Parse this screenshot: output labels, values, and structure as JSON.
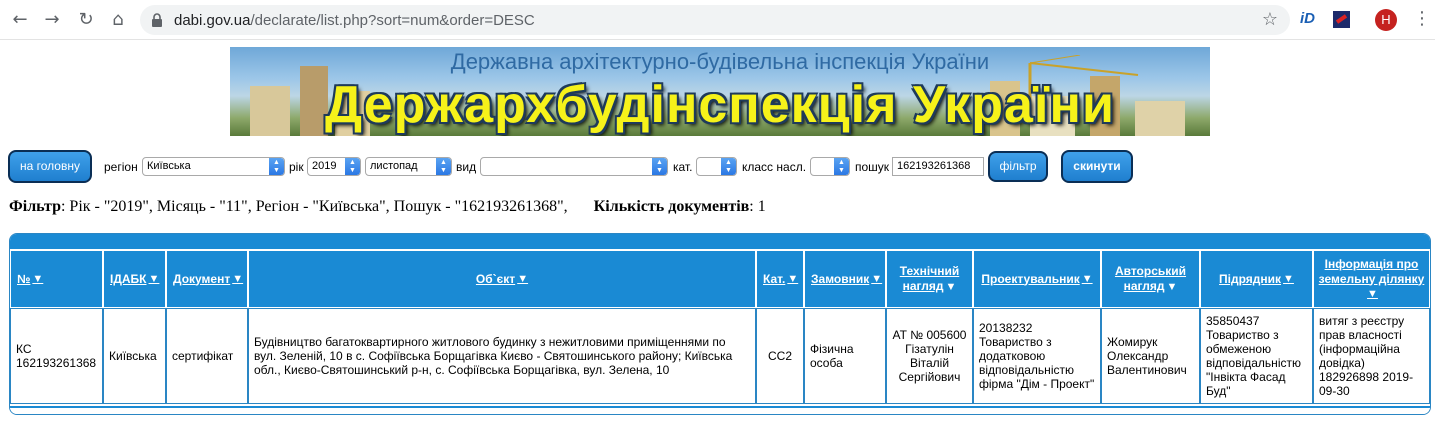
{
  "browser": {
    "url_host": "dabi.gov.ua",
    "url_path": "/declarate/list.php?sort=num&order=DESC",
    "ext_id_label": "iD",
    "avatar_letter": "H"
  },
  "banner": {
    "subtitle": "Державна архітектурно-будівельна інспекція України",
    "title": "Держархбудінспекція України"
  },
  "filters": {
    "home_button": "на головну",
    "region_label": "регіон",
    "region_value": "Київська",
    "year_label": "рік",
    "year_value": "2019",
    "month_value": "листопад",
    "type_label": "вид",
    "type_value": "",
    "cat_label": "кат.",
    "cat_value": "",
    "class_label": "класс насл.",
    "class_value": "",
    "search_label": "пошук",
    "search_value": "162193261368",
    "filter_button": "фільтр",
    "reset_button": "скинути"
  },
  "summary": {
    "filter_label": "Фільтр",
    "filter_text": ": Рік - \"2019\", Місяць - \"11\", Регіон - \"Київська\", Пошук - \"162193261368\",",
    "count_label": "Кількість документів",
    "count_value": ": 1"
  },
  "table": {
    "headers": [
      {
        "line1": "№",
        "line2": ""
      },
      {
        "line1": "ІДАБК",
        "line2": ""
      },
      {
        "line1": "Документ",
        "line2": ""
      },
      {
        "line1": "Об`єкт",
        "line2": ""
      },
      {
        "line1": "Кат.",
        "line2": ""
      },
      {
        "line1": "Замовник",
        "line2": ""
      },
      {
        "line1": "Технічний",
        "line2": "нагляд"
      },
      {
        "line1": "Проектувальник",
        "line2": ""
      },
      {
        "line1": "Авторський",
        "line2": "нагляд"
      },
      {
        "line1": "Підрядник",
        "line2": ""
      },
      {
        "line1": "Інформація про",
        "line2": "земельну ділянку"
      }
    ],
    "row": {
      "num": "КС 162193261368",
      "idabk": "Київська",
      "document": "сертифікат",
      "object": "Будівництво багатоквартирного житлового будинку з нежитловими приміщеннями по вул. Зеленій, 10 в с. Софіївська Борщагівка Києво - Святошинського району; Київська обл., Києво-Святошинський р-н, с. Софіївська Борщагівка, вул. Зелена, 10",
      "category": "СС2",
      "customer": "Фізична особа",
      "tech_supervision": "АТ № 005600 Гізатулін Віталій Сергійович",
      "designer": "20138232 Товариство з додатковою відповідальністю фірма \"Дім - Проект\"",
      "author_supervision": "Жомирук Олександр Валентинович",
      "contractor": "35850437 Товариство з обмеженою відповідальністю \"Інвікта Фасад Буд\"",
      "land_info": "витяг з реєстру прав власності (інформаційна довідка) 182926898 2019-09-30"
    }
  }
}
